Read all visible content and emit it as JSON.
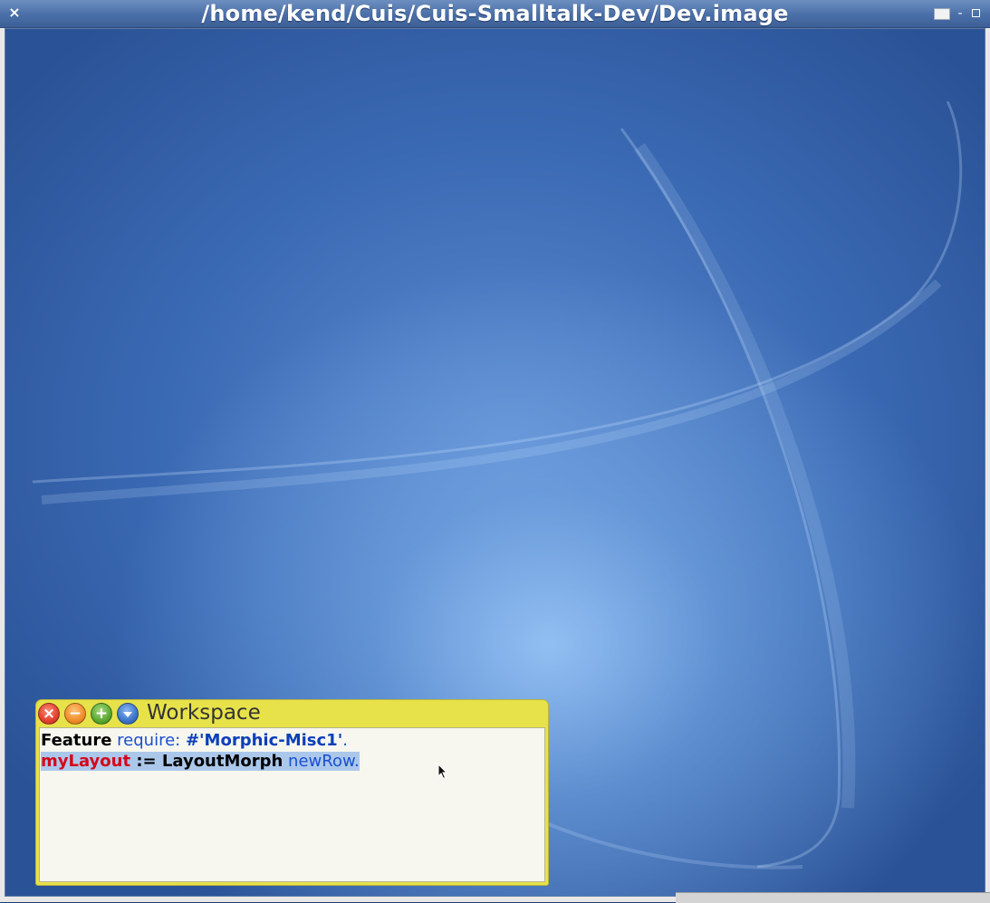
{
  "window": {
    "title": "/home/kend/Cuis/Cuis-Smalltalk-Dev/Dev.image",
    "close_glyph": "×",
    "minimize_glyph": "-"
  },
  "workspace": {
    "title": "Workspace",
    "buttons": {
      "close_glyph": "×",
      "collapse_glyph": "−",
      "expand_glyph": "+"
    },
    "code": {
      "line1": {
        "class_name": "Feature",
        "keyword": " require: ",
        "symbol": "#'Morphic-Misc1'",
        "terminator": "."
      },
      "line2": {
        "variable": "myLayout",
        "assign": " := LayoutMorph",
        "message": " newRow.",
        "selected": true
      }
    }
  },
  "colors": {
    "title_bar": "#4a6fa8",
    "desktop": "#3a69b3",
    "workspace_frame": "#e7e24a",
    "selection": "#abc8eb",
    "variable": "#d4061a",
    "keyword": "#1a4fd0"
  },
  "icons": [
    "close-icon",
    "collapse-icon",
    "expand-icon",
    "menu-icon",
    "mouse-cursor-icon"
  ]
}
